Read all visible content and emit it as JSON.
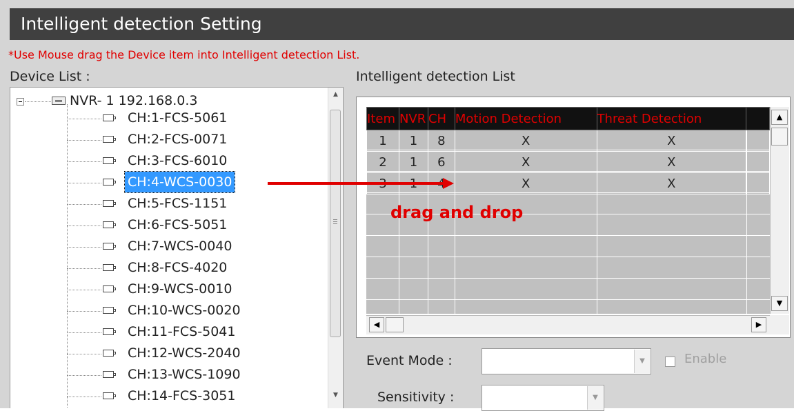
{
  "window": {
    "title": "Intelligent detection Setting"
  },
  "hint": "*Use Mouse drag the Device item into Intelligent detection List.",
  "device_list": {
    "label": "Device List :",
    "root": "NVR- 1 192.168.0.3",
    "selected_index": 3,
    "channels": [
      "CH:1-FCS-5061",
      "CH:2-FCS-0071",
      "CH:3-FCS-6010",
      "CH:4-WCS-0030",
      "CH:5-FCS-1151",
      "CH:6-FCS-5051",
      "CH:7-WCS-0040",
      "CH:8-FCS-4020",
      "CH:9-WCS-0010",
      "CH:10-WCS-0020",
      "CH:11-FCS-5041",
      "CH:12-WCS-2040",
      "CH:13-WCS-1090",
      "CH:14-FCS-3051"
    ]
  },
  "detection_list": {
    "label": "Intelligent detection List",
    "headers": [
      "Item",
      "NVR",
      "CH",
      "Motion Detection",
      "Threat Detection"
    ],
    "rows": [
      [
        "1",
        "1",
        "8",
        "X",
        "X"
      ],
      [
        "2",
        "1",
        "6",
        "X",
        "X"
      ],
      [
        "3",
        "1",
        "4",
        "X",
        "X"
      ]
    ]
  },
  "event_mode": {
    "label": "Event Mode :",
    "value": ""
  },
  "enable": {
    "label": "Enable",
    "checked": false
  },
  "sensitivity": {
    "label": "Sensitivity :",
    "value": ""
  },
  "annotation": {
    "text": "drag and drop",
    "color": "#e00000"
  },
  "colors": {
    "accent": "#e00000",
    "selection": "#3399ff",
    "titlebar": "#404040",
    "header_bg": "#111111"
  }
}
